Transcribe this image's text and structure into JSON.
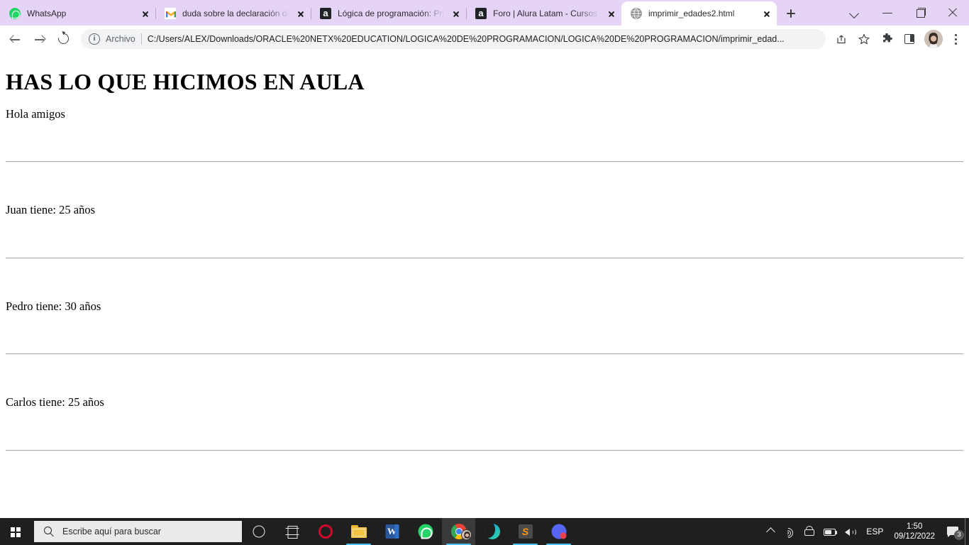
{
  "browser": {
    "tabs": [
      {
        "title": "WhatsApp",
        "favicon": "whatsapp-icon",
        "active": false
      },
      {
        "title": "duda sobre la declaración de",
        "favicon": "gmail-icon",
        "active": false
      },
      {
        "title": "Lógica de programación: Prin",
        "favicon": "alura-icon",
        "active": false
      },
      {
        "title": "Foro | Alura Latam - Cursos o",
        "favicon": "alura-icon",
        "active": false
      },
      {
        "title": "imprimir_edades2.html",
        "favicon": "globe-icon",
        "active": true
      }
    ],
    "alura_favicon_letter": "a",
    "new_tab_label": "+",
    "window_controls": {
      "tab_search": "tab-search-chevron",
      "minimize": "minimize",
      "maximize": "restore",
      "close": "close"
    },
    "toolbar": {
      "back": "back-arrow",
      "forward": "forward-arrow",
      "reload": "reload",
      "scheme_label": "Archivo",
      "info_glyph": "i",
      "url": "C:/Users/ALEX/Downloads/ORACLE%20NETX%20EDUCATION/LOGICA%20DE%20PROGRAMACION/LOGICA%20DE%20PROGRAMACION/imprimir_edad...",
      "share": "share-icon",
      "bookmark": "star-icon",
      "extensions": "puzzle-icon",
      "side_panel": "side-panel-icon",
      "profile": "profile-avatar",
      "menu": "three-dot-menu"
    }
  },
  "page": {
    "heading": "HAS LO QUE HICIMOS EN AULA",
    "intro": "Hola amigos",
    "entries": [
      "Juan tiene: 25 años",
      "Pedro tiene: 30 años",
      "Carlos tiene: 25 años"
    ]
  },
  "taskbar": {
    "start": "windows-start",
    "search_placeholder": "Escribe aquí para buscar",
    "apps": [
      {
        "name": "cortana",
        "active": false,
        "running": false
      },
      {
        "name": "task-view",
        "active": false,
        "running": false
      },
      {
        "name": "opera",
        "active": false,
        "running": false
      },
      {
        "name": "file-explorer",
        "active": false,
        "running": true
      },
      {
        "name": "word",
        "active": false,
        "running": false
      },
      {
        "name": "whatsapp",
        "active": false,
        "running": false
      },
      {
        "name": "chrome",
        "active": true,
        "running": true
      },
      {
        "name": "edge",
        "active": false,
        "running": false
      },
      {
        "name": "sublime-text",
        "active": false,
        "running": true
      },
      {
        "name": "discord",
        "active": false,
        "running": true
      }
    ],
    "word_letter": "W",
    "sublime_letter": "S",
    "tray": {
      "language": "ESP",
      "time": "1:50",
      "date": "09/12/2022",
      "notification_count": "3"
    }
  },
  "colors": {
    "tabstrip_bg": "#e6d4f7",
    "active_tab_bg": "#ffffff",
    "taskbar_bg": "#1f1f1f",
    "omnibox_bg": "#f1f3f4",
    "running_underline": "#4cc2f1"
  }
}
